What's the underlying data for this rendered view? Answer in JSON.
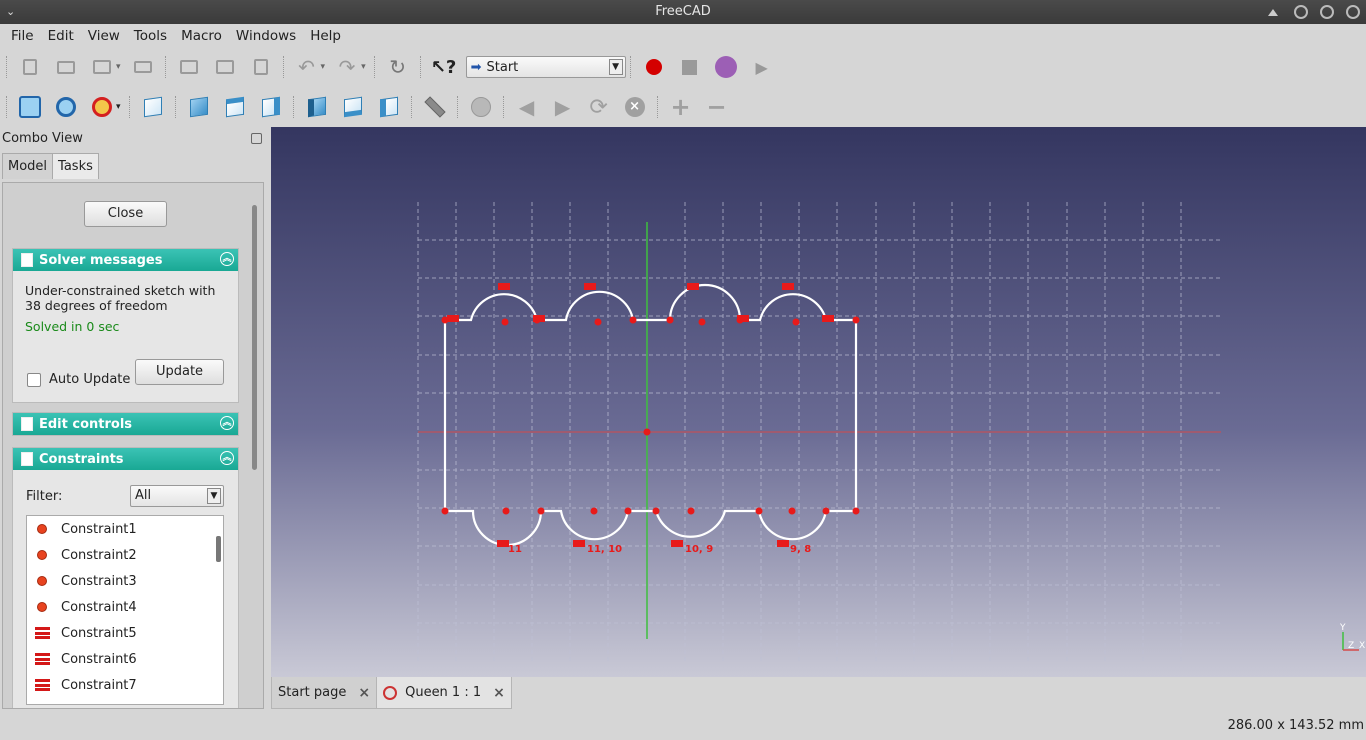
{
  "window": {
    "title": "FreeCAD"
  },
  "menu": [
    "File",
    "Edit",
    "View",
    "Tools",
    "Macro",
    "Windows",
    "Help"
  ],
  "toolbar": {
    "workbench": "Start"
  },
  "combo_view": {
    "title": "Combo View",
    "tabs": [
      "Model",
      "Tasks"
    ],
    "active_tab": "Tasks",
    "close_label": "Close",
    "solver": {
      "header": "Solver messages",
      "message": "Under-constrained sketch with 38 degrees of freedom",
      "solved": "Solved in 0 sec",
      "auto_update_label": "Auto Update",
      "update_label": "Update"
    },
    "edit_controls": {
      "header": "Edit controls"
    },
    "constraints": {
      "header": "Constraints",
      "filter_label": "Filter:",
      "filter_value": "All",
      "items": [
        {
          "label": "Constraint1",
          "kind": "coincident"
        },
        {
          "label": "Constraint2",
          "kind": "coincident"
        },
        {
          "label": "Constraint3",
          "kind": "coincident"
        },
        {
          "label": "Constraint4",
          "kind": "coincident"
        },
        {
          "label": "Constraint5",
          "kind": "equal"
        },
        {
          "label": "Constraint6",
          "kind": "equal"
        },
        {
          "label": "Constraint7",
          "kind": "equal"
        }
      ]
    }
  },
  "sketch_labels": [
    "11",
    "11, 10",
    "10, 9",
    "9, 8"
  ],
  "axis_labels": {
    "y": "Y",
    "z": "Z",
    "x": "X"
  },
  "doc_tabs": [
    {
      "label": "Start page",
      "active": false
    },
    {
      "label": "Queen 1 : 1",
      "active": true
    }
  ],
  "status": {
    "dimensions": "286.00 x 143.52 mm"
  },
  "colors": {
    "accent_teal": "#19a894",
    "constraint_red": "#d41818",
    "viewport_top": "#343660"
  }
}
